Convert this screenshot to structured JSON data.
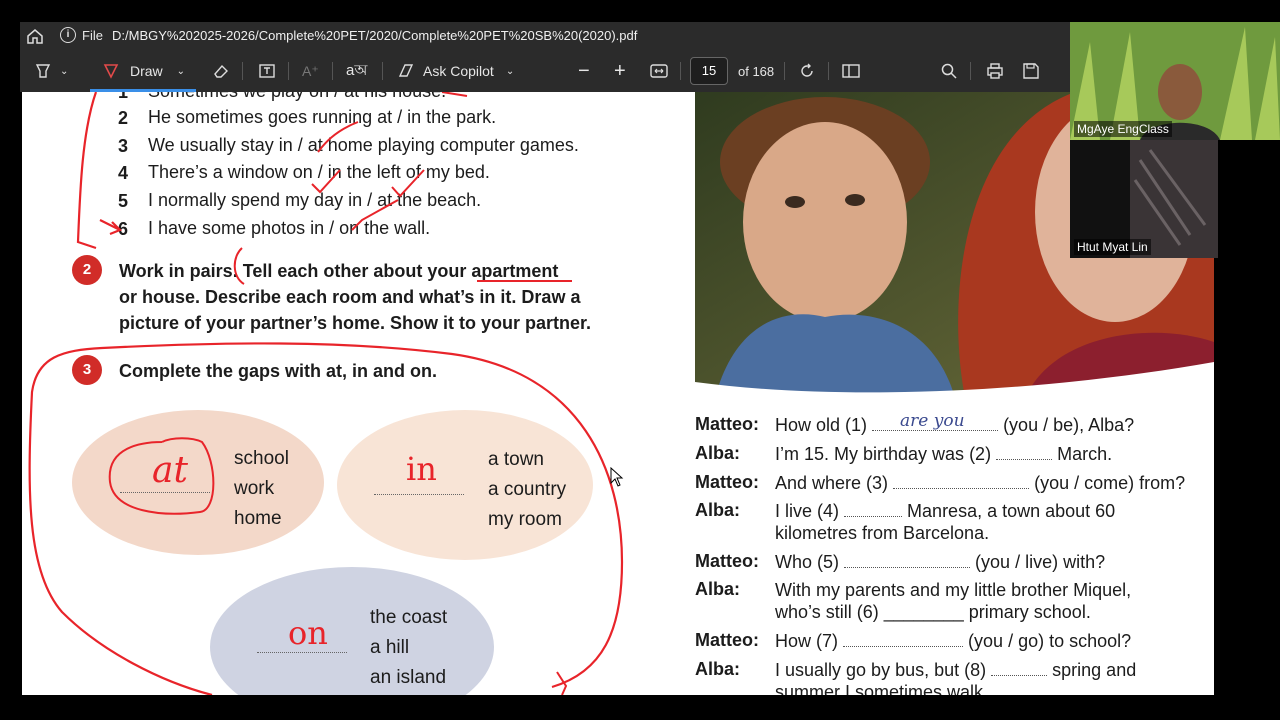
{
  "address_bar": {
    "file_label": "File",
    "path": "D:/MBGY%202025-2026/Complete%20PET/2020/Complete%20PET%20SB%20(2020).pdf"
  },
  "toolbar": {
    "draw_label": "Draw",
    "ask_copilot_label": "Ask Copilot",
    "page_current": "15",
    "page_total": "of 168",
    "icons": [
      "highlight-icon",
      "draw-icon",
      "eraser-icon",
      "text-box-icon",
      "read-aloud-icon",
      "translate-icon",
      "copilot-icon",
      "zoom-out-icon",
      "zoom-in-icon",
      "fit-page-icon",
      "rotate-icon",
      "page-view-icon",
      "search-icon",
      "print-icon",
      "save-icon"
    ]
  },
  "exercise1": {
    "items": [
      {
        "num": "1",
        "text": "Sometimes we play on / at his house."
      },
      {
        "num": "2",
        "text": "He sometimes goes running at / in the park."
      },
      {
        "num": "3",
        "text": "We usually stay in / at home playing computer games."
      },
      {
        "num": "4",
        "text": "There’s a window on / in the left of my bed."
      },
      {
        "num": "5",
        "text": "I normally spend my day in / at the beach."
      },
      {
        "num": "6",
        "text": "I have some photos in / on the wall."
      }
    ]
  },
  "exercise2": {
    "number": "2",
    "lines": [
      "Work in pairs. Tell each other about your apartment",
      "or house. Describe each room and what’s in it. Draw a",
      "picture of your partner’s home. Show it to your partner."
    ]
  },
  "exercise3": {
    "number": "3",
    "instruction": "Complete the gaps with at, in and on.",
    "groups": [
      {
        "answer": "at",
        "words": [
          "school",
          "work",
          "home"
        ]
      },
      {
        "answer": "in",
        "words": [
          "a town",
          "a country",
          "my room"
        ]
      },
      {
        "answer": "on",
        "words": [
          "the coast",
          "a hill",
          "an island"
        ]
      }
    ]
  },
  "dialogue": [
    {
      "speaker": "Matteo:",
      "before": "How old (1)",
      "fill": "are you",
      "after": "(you / be), Alba?"
    },
    {
      "speaker": "Alba:",
      "before": "I’m 15. My birthday was (2)",
      "fill": "",
      "after": "March."
    },
    {
      "speaker": "Matteo:",
      "before": "And where (3)",
      "fill": "",
      "after": "(you / come) from?"
    },
    {
      "speaker": "Alba:",
      "before": "I live (4)",
      "fill": "",
      "after": "Manresa, a town about 60",
      "line2": "kilometres from Barcelona."
    },
    {
      "speaker": "Matteo:",
      "before": "Who (5)",
      "fill": "",
      "after": "(you / live) with?"
    },
    {
      "speaker": "Alba:",
      "before": "With my parents and my little brother Miquel,",
      "fill": "",
      "after": "",
      "line2": "who’s still (6) ________ primary school."
    },
    {
      "speaker": "Matteo:",
      "before": "How (7)",
      "fill": "",
      "after": "(you / go) to school?"
    },
    {
      "speaker": "Alba:",
      "before": "I usually go by bus, but (8)",
      "fill": "",
      "after": "spring and",
      "line2": "summer I sometimes walk."
    }
  ],
  "participants": [
    {
      "name": "MgAye EngClass"
    },
    {
      "name": "Htut Myat Lin"
    }
  ]
}
